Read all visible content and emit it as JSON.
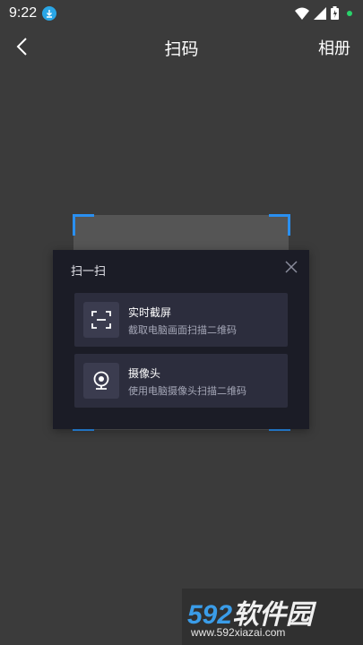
{
  "status_bar": {
    "time": "9:22",
    "icons": [
      "download-icon",
      "wifi-icon",
      "signal-icon",
      "battery-icon",
      "notification-dot-icon"
    ]
  },
  "nav": {
    "back_icon": "chevron-left-icon",
    "title": "扫码",
    "album_label": "相册"
  },
  "dialog": {
    "title": "扫一扫",
    "close_icon": "close-icon",
    "options": [
      {
        "icon": "screenshot-frame-icon",
        "title": "实时截屏",
        "description": "截取电脑画面扫描二维码"
      },
      {
        "icon": "webcam-icon",
        "title": "摄像头",
        "description": "使用电脑摄像头扫描二维码"
      }
    ]
  },
  "watermark": {
    "logo_number": "592",
    "logo_text": "软件园",
    "url": "www.592xiazai.com"
  },
  "colors": {
    "background": "#3b3b3b",
    "scan_corner": "#2a8ff0",
    "dialog_bg": "#1b1c26",
    "option_bg": "#2c2d3d",
    "download_badge": "#2aa6e6",
    "notification_dot": "#29d36b"
  }
}
